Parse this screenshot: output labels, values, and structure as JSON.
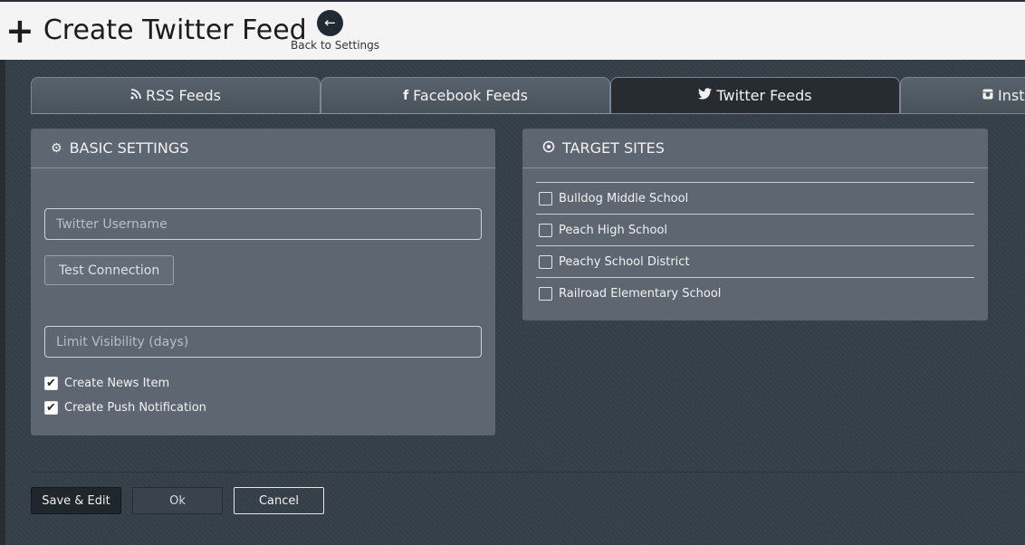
{
  "header": {
    "title": "Create Twitter Feed",
    "title_icon": "+",
    "back_label": "Back to Settings",
    "back_icon": "arrow-left-icon"
  },
  "tabs": [
    {
      "label": "RSS Feeds",
      "icon": "rss-icon",
      "glyph": "⊙",
      "active": false
    },
    {
      "label": "Facebook Feeds",
      "icon": "facebook-icon",
      "glyph": "f",
      "active": false
    },
    {
      "label": "Twitter Feeds",
      "icon": "twitter-icon",
      "glyph": "✦",
      "active": true
    },
    {
      "label": "Insta",
      "icon": "instagram-icon",
      "glyph": "▣",
      "active": false
    }
  ],
  "basic_settings": {
    "title": "BASIC SETTINGS",
    "icon": "gear-icon",
    "username_placeholder": "Twitter Username",
    "test_connection_label": "Test Connection",
    "limit_placeholder": "Limit Visibility (days)",
    "options": [
      {
        "label": "Create News Item",
        "checked": true
      },
      {
        "label": "Create Push Notification",
        "checked": true
      }
    ]
  },
  "target_sites": {
    "title": "TARGET SITES",
    "icon": "target-icon",
    "sites": [
      {
        "label": "Bulldog Middle School",
        "checked": false
      },
      {
        "label": "Peach High School",
        "checked": false
      },
      {
        "label": "Peachy School District",
        "checked": false
      },
      {
        "label": "Railroad Elementary School",
        "checked": false
      }
    ]
  },
  "footer": {
    "save_edit_label": "Save & Edit",
    "ok_label": "Ok",
    "cancel_label": "Cancel"
  },
  "colors": {
    "background": "#343e47",
    "panel": "#5e6771",
    "header": "#f4f4f4",
    "active_tab": "#262c32"
  }
}
